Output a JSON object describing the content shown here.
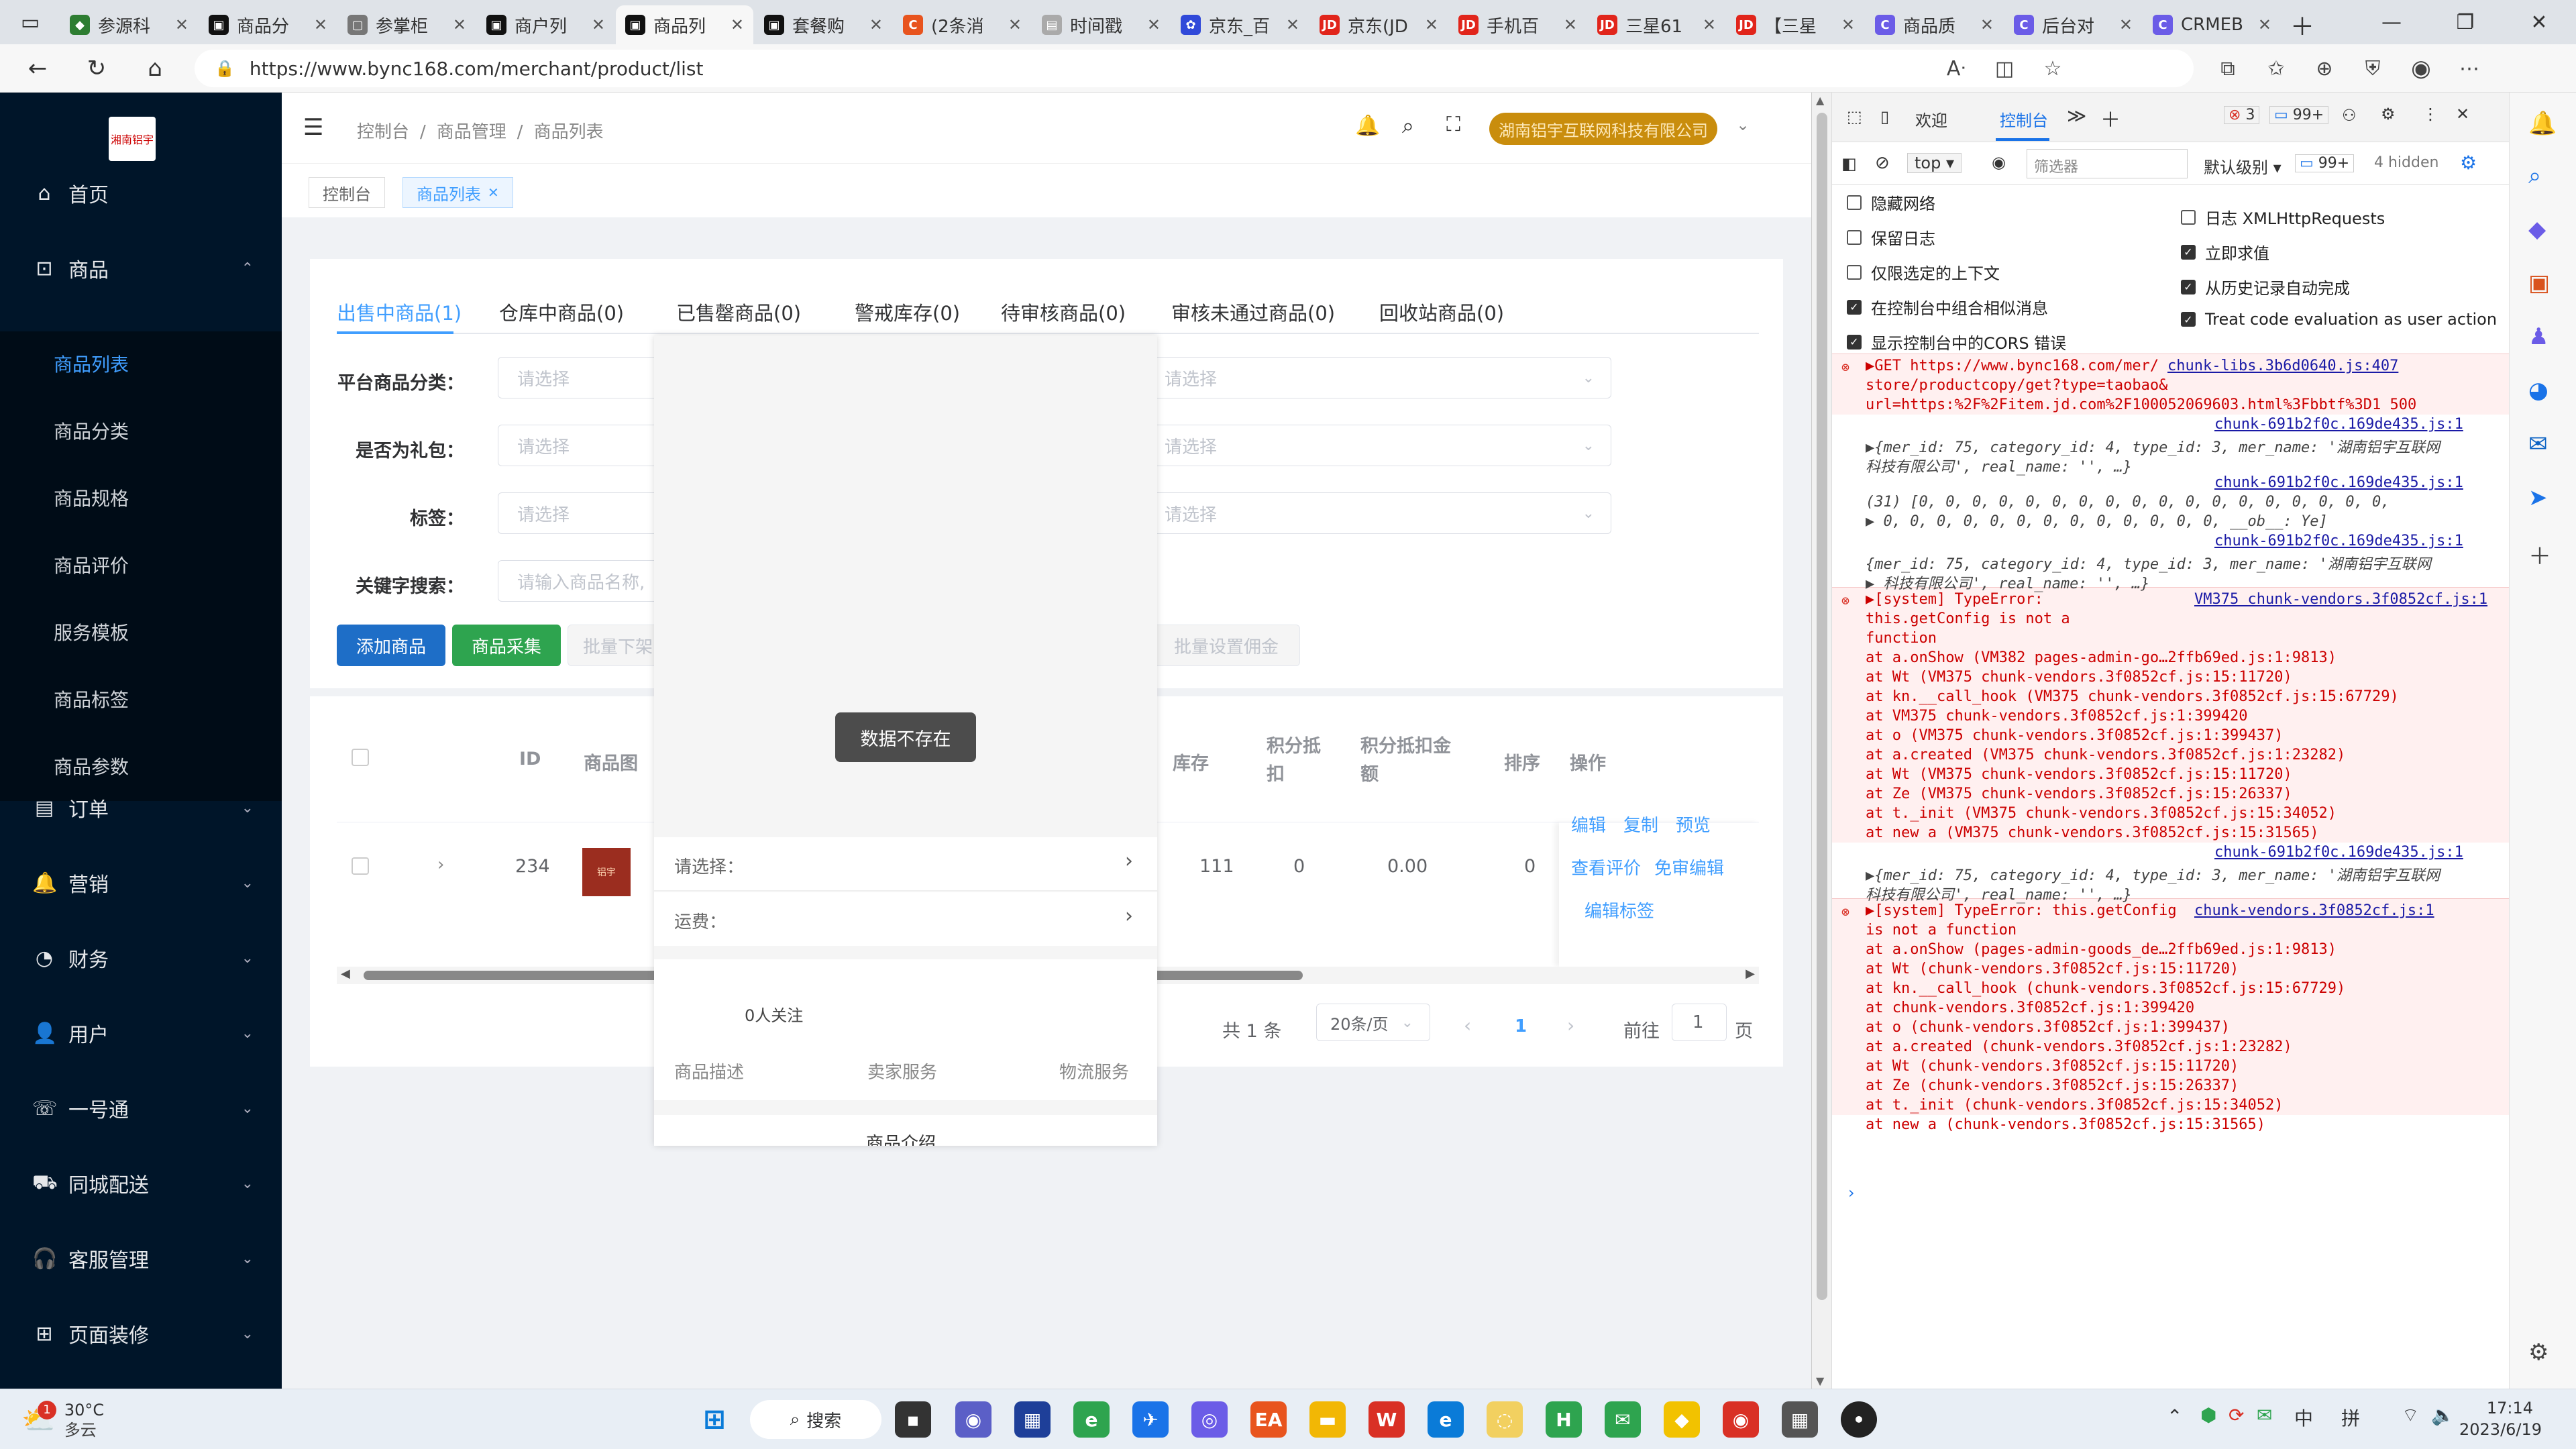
{
  "browser": {
    "tabs": [
      {
        "label": "参源科",
        "fav": "#2e7d32",
        "glyph": "◆"
      },
      {
        "label": "商品分",
        "fav": "#111111",
        "glyph": "▣"
      },
      {
        "label": "参掌柜",
        "fav": "#777777",
        "glyph": "▢"
      },
      {
        "label": "商户列",
        "fav": "#111111",
        "glyph": "▣"
      },
      {
        "label": "商品列",
        "fav": "#111111",
        "glyph": "▣"
      },
      {
        "label": "套餐购",
        "fav": "#111111",
        "glyph": "▣"
      },
      {
        "label": "(2条消",
        "fav": "#e8541e",
        "glyph": "C"
      },
      {
        "label": "时间戳",
        "fav": "#aaaaaa",
        "glyph": "▤"
      },
      {
        "label": "京东_百",
        "fav": "#3049d9",
        "glyph": "✿"
      },
      {
        "label": "京东(JD",
        "fav": "#e1251b",
        "glyph": "JD"
      },
      {
        "label": "手机百",
        "fav": "#e1251b",
        "glyph": "JD"
      },
      {
        "label": "三星61",
        "fav": "#e1251b",
        "glyph": "JD"
      },
      {
        "label": "【三星",
        "fav": "#e1251b",
        "glyph": "JD"
      },
      {
        "label": "商品质",
        "fav": "#6b5ce7",
        "glyph": "C"
      },
      {
        "label": "后台对",
        "fav": "#6b5ce7",
        "glyph": "C"
      },
      {
        "label": "CRMEB",
        "fav": "#6b5ce7",
        "glyph": "C"
      }
    ],
    "url": "https://www.bync168.com/merchant/product/list"
  },
  "sidebar": {
    "logo_text": "湘南铝宇",
    "items": [
      {
        "label": "首页",
        "icon": "⌂"
      },
      {
        "label": "商品",
        "icon": "⊡"
      },
      {
        "label": "订单",
        "icon": "▤"
      },
      {
        "label": "营销",
        "icon": "🔔"
      },
      {
        "label": "财务",
        "icon": "◔"
      },
      {
        "label": "用户",
        "icon": "👤"
      },
      {
        "label": "一号通",
        "icon": "☏"
      },
      {
        "label": "同城配送",
        "icon": "⛟"
      },
      {
        "label": "客服管理",
        "icon": "🎧"
      },
      {
        "label": "页面装修",
        "icon": "⊞"
      }
    ],
    "sub_items": [
      "商品列表",
      "商品分类",
      "商品规格",
      "商品评价",
      "服务模板",
      "商品标签",
      "商品参数"
    ]
  },
  "header": {
    "breadcrumb": [
      "控制台",
      "/",
      "商品管理",
      "/",
      "商品列表"
    ],
    "company": "湖南铝宇互联网科技有限公司"
  },
  "tags": {
    "home": "控制台",
    "current": "商品列表"
  },
  "product_tabs": [
    "出售中商品(1)",
    "仓库中商品(0)",
    "已售罄商品(0)",
    "警戒库存(0)",
    "待审核商品(0)",
    "审核未通过商品(0)",
    "回收站商品(0)"
  ],
  "filters": {
    "platform_category": "平台商品分类：",
    "is_gift": "是否为礼包：",
    "tag": "标签：",
    "keyword": "关键字搜索：",
    "select_placeholder": "请选择",
    "keyword_placeholder": "请输入商品名称,"
  },
  "actions": {
    "add": "添加商品",
    "collect": "商品采集",
    "batch_off": "批量下架",
    "batch_commission": "批量设置佣金"
  },
  "table": {
    "headers": [
      "ID",
      "商品图",
      "库存",
      "积分抵扣",
      "积分抵扣金额",
      "排序",
      "操作"
    ],
    "row": {
      "id": "234",
      "stock": "111",
      "points": "0",
      "points_amount": "0.00",
      "sort": "0",
      "thumb_text": "铝宇"
    },
    "ops": [
      "编辑",
      "复制",
      "预览",
      "查看评价",
      "免审编辑",
      "编辑标签"
    ]
  },
  "pagination": {
    "total": "共 1 条",
    "page_size": "20条/页",
    "current": "1",
    "goto": "前往",
    "goto_value": "1",
    "page_unit": "页"
  },
  "modal": {
    "toast": "数据不存在",
    "select_label": "请选择：",
    "freight_label": "运费：",
    "follow": "0人关注",
    "tabs": [
      "商品描述",
      "卖家服务",
      "物流服务"
    ],
    "bottom_text": "商品介绍"
  },
  "devtools": {
    "tabs": [
      "欢迎",
      "控制台"
    ],
    "error_count": "3",
    "msg_count": "99+",
    "context": "top",
    "filter_placeholder": "筛选器",
    "level": "默认级别",
    "level_count": "99+",
    "hidden": "4 hidden",
    "settings_left": [
      {
        "label": "隐藏网络",
        "checked": false
      },
      {
        "label": "保留日志",
        "checked": false
      },
      {
        "label": "仅限选定的上下文",
        "checked": false
      },
      {
        "label": "在控制台中组合相似消息",
        "checked": true
      },
      {
        "label": "显示控制台中的CORS 错误",
        "checked": true
      }
    ],
    "settings_right": [
      {
        "label": "日志 XMLHttpRequests",
        "checked": false
      },
      {
        "label": "立即求值",
        "checked": true
      },
      {
        "label": "从历史记录自动完成",
        "checked": true
      },
      {
        "label": "Treat code evaluation as user action",
        "checked": true
      }
    ],
    "console": [
      {
        "t": "err",
        "text": "▶GET https://www.bync168.com/mer/",
        "src": "chunk-libs.3b6d0640.js:407"
      },
      {
        "t": "err",
        "text": "store/productcopy/get?type=taobao&"
      },
      {
        "t": "err",
        "text": "url=https:%2F%2Fitem.jd.com%2F100052069603.html%3Fbbtf%3D1  500"
      },
      {
        "t": "src",
        "text": "chunk-691b2f0c.169de435.js:1"
      },
      {
        "t": "obj",
        "text": "▶{mer_id: 75, category_id: 4, type_id: 3, mer_name: '湖南铝宇互联网"
      },
      {
        "t": "obj",
        "text": "  科技有限公司', real_name: '', …}"
      },
      {
        "t": "src",
        "text": "chunk-691b2f0c.169de435.js:1"
      },
      {
        "t": "obj",
        "text": "  (31) [0, 0, 0, 0, 0, 0, 0, 0, 0, 0, 0, 0, 0, 0, 0, 0, 0, 0,"
      },
      {
        "t": "obj",
        "text": "▶ 0, 0, 0, 0, 0, 0, 0, 0, 0, 0, 0, 0, 0, __ob__: Ye]"
      },
      {
        "t": "src",
        "text": "chunk-691b2f0c.169de435.js:1"
      },
      {
        "t": "obj",
        "text": "  {mer_id: 75, category_id: 4, type_id: 3, mer_name: '湖南铝宇互联网"
      },
      {
        "t": "obj",
        "text": "▶ 科技有限公司', real_name: '', …}"
      },
      {
        "t": "err",
        "text": "▶[system] TypeError:",
        "src": "VM375 chunk-vendors.3f0852cf.js:1"
      },
      {
        "t": "err",
        "text": "this.getConfig is not a"
      },
      {
        "t": "err",
        "text": "function"
      },
      {
        "t": "err",
        "text": "    at a.onShow (VM382 pages-admin-go…2ffb69ed.js:1:9813)"
      },
      {
        "t": "err",
        "text": "    at Wt (VM375 chunk-vendors.3f0852cf.js:15:11720)"
      },
      {
        "t": "err",
        "text": "    at kn.__call_hook (VM375 chunk-vendors.3f0852cf.js:15:67729)"
      },
      {
        "t": "err",
        "text": "    at VM375 chunk-vendors.3f0852cf.js:1:399420"
      },
      {
        "t": "err",
        "text": "    at o (VM375 chunk-vendors.3f0852cf.js:1:399437)"
      },
      {
        "t": "err",
        "text": "    at a.created (VM375 chunk-vendors.3f0852cf.js:1:23282)"
      },
      {
        "t": "err",
        "text": "    at Wt (VM375 chunk-vendors.3f0852cf.js:15:11720)"
      },
      {
        "t": "err",
        "text": "    at Ze (VM375 chunk-vendors.3f0852cf.js:15:26337)"
      },
      {
        "t": "err",
        "text": "    at t._init (VM375 chunk-vendors.3f0852cf.js:15:34052)"
      },
      {
        "t": "err",
        "text": "    at new a (VM375 chunk-vendors.3f0852cf.js:15:31565)"
      },
      {
        "t": "src",
        "text": "chunk-691b2f0c.169de435.js:1"
      },
      {
        "t": "obj",
        "text": "▶{mer_id: 75, category_id: 4, type_id: 3, mer_name: '湖南铝宇互联网"
      },
      {
        "t": "obj",
        "text": "  科技有限公司', real_name: '', …}"
      },
      {
        "t": "err",
        "text": "▶[system] TypeError: this.getConfig",
        "src": "chunk-vendors.3f0852cf.js:1"
      },
      {
        "t": "err",
        "text": "is not a function"
      },
      {
        "t": "err",
        "text": "    at a.onShow (pages-admin-goods_de…2ffb69ed.js:1:9813)"
      },
      {
        "t": "err",
        "text": "    at Wt (chunk-vendors.3f0852cf.js:15:11720)"
      },
      {
        "t": "err",
        "text": "    at kn.__call_hook (chunk-vendors.3f0852cf.js:15:67729)"
      },
      {
        "t": "err",
        "text": "    at chunk-vendors.3f0852cf.js:1:399420"
      },
      {
        "t": "err",
        "text": "    at o (chunk-vendors.3f0852cf.js:1:399437)"
      },
      {
        "t": "err",
        "text": "    at a.created (chunk-vendors.3f0852cf.js:1:23282)"
      },
      {
        "t": "err",
        "text": "    at Wt (chunk-vendors.3f0852cf.js:15:11720)"
      },
      {
        "t": "err",
        "text": "    at Ze (chunk-vendors.3f0852cf.js:15:26337)"
      },
      {
        "t": "err",
        "text": "    at t._init (chunk-vendors.3f0852cf.js:15:34052)"
      },
      {
        "t": "err",
        "text": "    at new a (chunk-vendors.3f0852cf.js:15:31565)"
      }
    ]
  },
  "taskbar": {
    "weather_temp": "30°C",
    "weather_desc": "多云",
    "weather_badge": "1",
    "search": "搜索",
    "ime_lang": "中",
    "ime_mode": "拼",
    "time": "17:14",
    "date": "2023/6/19"
  },
  "colors": {
    "sidebar_bg": "#001529",
    "accent": "#409eff",
    "add_btn": "#1e6ec7",
    "collect_btn": "#2ea44f"
  }
}
